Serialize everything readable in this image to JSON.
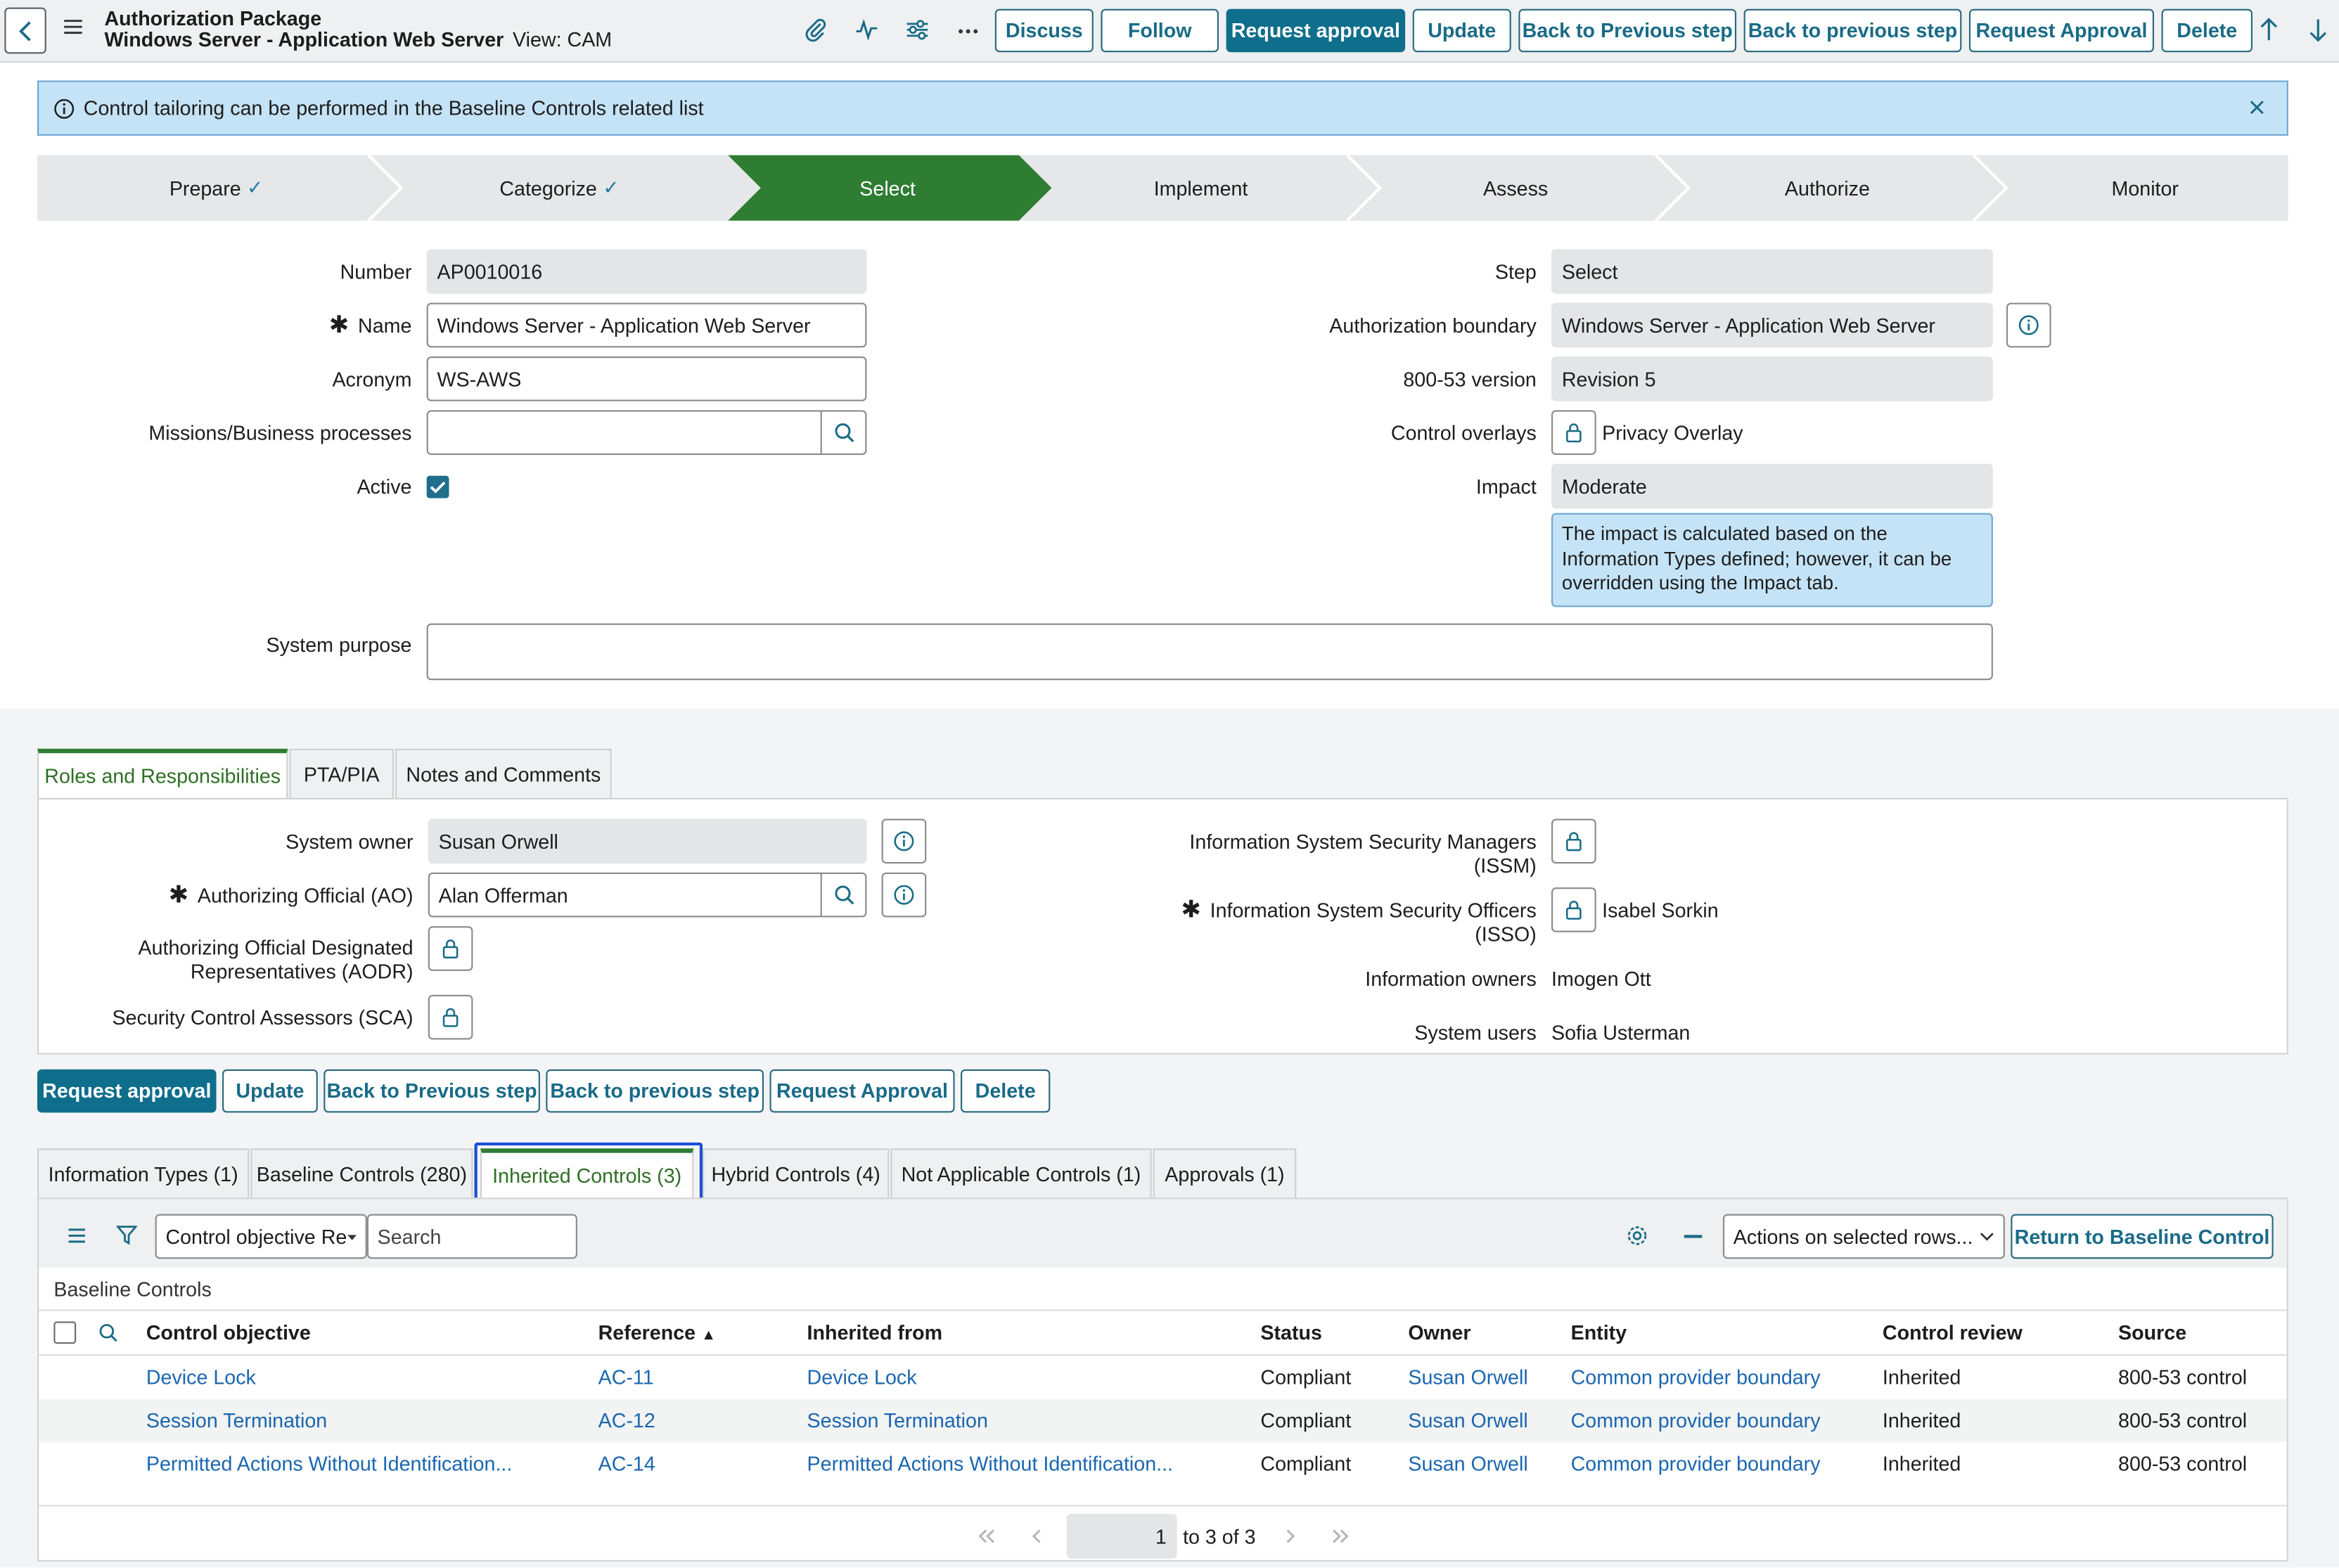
{
  "header": {
    "title_line1": "Authorization Package",
    "title_line2": "Windows Server - Application Web Server",
    "view": "View: CAM",
    "buttons": [
      "Discuss",
      "Follow",
      "Request approval",
      "Update",
      "Back to Previous step",
      "Back to previous step",
      "Request Approval",
      "Delete"
    ]
  },
  "info_message": "Control tailoring can be performed in the Baseline Controls related list",
  "process_flow": {
    "stages": [
      {
        "label": "Prepare",
        "state": "complete"
      },
      {
        "label": "Categorize",
        "state": "complete"
      },
      {
        "label": "Select",
        "state": "current"
      },
      {
        "label": "Implement",
        "state": "pending"
      },
      {
        "label": "Assess",
        "state": "pending"
      },
      {
        "label": "Authorize",
        "state": "pending"
      },
      {
        "label": "Monitor",
        "state": "pending"
      }
    ],
    "checkmark": "✓",
    "current_color": "#2e7d32"
  },
  "form": {
    "number_label": "Number",
    "number_value": "AP0010016",
    "name_label": "Name",
    "name_value": "Windows Server - Application Web Server",
    "acronym_label": "Acronym",
    "acronym_value": "WS-AWS",
    "missions_label": "Missions/Business processes",
    "missions_value": "",
    "active_label": "Active",
    "active_checked": true,
    "step_label": "Step",
    "step_value": "Select",
    "boundary_label": "Authorization boundary",
    "boundary_value": "Windows Server - Application Web Server",
    "version_label": "800-53 version",
    "version_value": "Revision 5",
    "overlays_label": "Control overlays",
    "overlays_value": "Privacy Overlay",
    "impact_label": "Impact",
    "impact_value": "Moderate",
    "impact_note": "The impact is calculated based on the Information Types defined; however, it can be overridden using the Impact tab.",
    "purpose_label": "System purpose",
    "purpose_value": ""
  },
  "roles_tabs": [
    "Roles and Responsibilities",
    "PTA/PIA",
    "Notes and Comments"
  ],
  "roles": {
    "owner_label": "System owner",
    "owner_value": "Susan Orwell",
    "ao_label": "Authorizing Official (AO)",
    "ao_value": "Alan Offerman",
    "aodr_label_1": "Authorizing Official Designated",
    "aodr_label_2": "Representatives (AODR)",
    "sca_label": "Security Control Assessors (SCA)",
    "issm_label_1": "Information System Security Managers",
    "issm_label_2": "(ISSM)",
    "isso_label_1": "Information System Security Officers",
    "isso_label_2": "(ISSO)",
    "isso_value": "Isabel Sorkin",
    "info_owners_label": "Information owners",
    "info_owners_value": "Imogen Ott",
    "system_users_label": "System users",
    "system_users_value": "Sofia Usterman"
  },
  "bottom_buttons": [
    "Request approval",
    "Update",
    "Back to Previous step",
    "Back to previous step",
    "Request Approval",
    "Delete"
  ],
  "related_tabs": [
    "Information Types (1)",
    "Baseline Controls (280)",
    "Inherited Controls (3)",
    "Hybrid Controls (4)",
    "Not Applicable Controls (1)",
    "Approvals (1)"
  ],
  "related_list": {
    "filter_field": "Control objective Re",
    "search_placeholder": "Search",
    "actions_select": "Actions on selected rows...",
    "return_button": "Return to Baseline Control",
    "section_title": "Baseline Controls",
    "columns": [
      "Control objective",
      "Reference",
      "Inherited from",
      "Status",
      "Owner",
      "Entity",
      "Control review",
      "Source"
    ],
    "sort_indicator": "▲",
    "rows": [
      [
        "Device Lock",
        "AC-11",
        "Device Lock",
        "Compliant",
        "Susan Orwell",
        "Common provider boundary",
        "Inherited",
        "800-53 control"
      ],
      [
        "Session Termination",
        "AC-12",
        "Session Termination",
        "Compliant",
        "Susan Orwell",
        "Common provider boundary",
        "Inherited",
        "800-53 control"
      ],
      [
        "Permitted Actions Without Identification...",
        "AC-14",
        "Permitted Actions Without Identification...",
        "Compliant",
        "Susan Orwell",
        "Common provider boundary",
        "Inherited",
        "800-53 control"
      ]
    ],
    "pager": {
      "current": "1",
      "suffix": "to 3 of 3"
    }
  }
}
